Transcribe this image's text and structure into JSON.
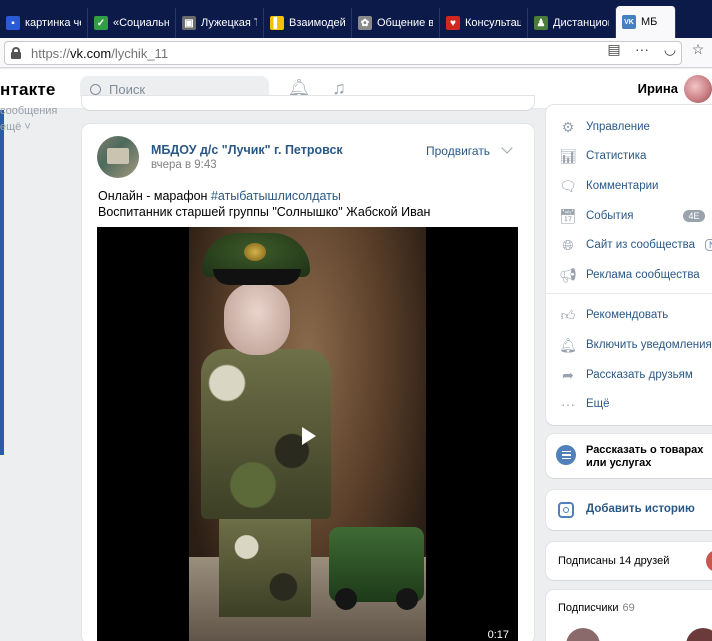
{
  "browser": {
    "tabs": [
      {
        "label": "картинка четв",
        "icon": "search-favicon",
        "color": "#2a5bd7"
      },
      {
        "label": "«Социальные",
        "icon": "check-favicon",
        "color": "#2f9e44"
      },
      {
        "label": "Лужецкая Т.А",
        "icon": "image-favicon",
        "color": "#6b6b6b"
      },
      {
        "label": "Взаимодейств",
        "icon": "yellow-bar-favicon",
        "color": "#f2c200"
      },
      {
        "label": "Общение в со",
        "icon": "leaf-favicon",
        "color": "#8a8a8a"
      },
      {
        "label": "Консультация",
        "icon": "heart-favicon",
        "color": "#d0281e"
      },
      {
        "label": "Дистанционн",
        "icon": "person-favicon",
        "color": "#4a7c3a"
      },
      {
        "label": "МБ",
        "icon": "vk-favicon",
        "color": "#4680c2"
      }
    ],
    "url_prefix": "https://",
    "url_host": "vk.com",
    "url_path": "/lychik_11"
  },
  "header": {
    "logo": "нтакте",
    "search_placeholder": "Поиск",
    "user_name": "Ирина"
  },
  "left": {
    "line1": "сообщения",
    "line2": "ещё ˅"
  },
  "post": {
    "author": "МБДОУ д/с \"Лучик\" г. Петровск",
    "time": "вчера в 9:43",
    "promote": "Продвигать",
    "text_prefix": "Онлайн - марафон ",
    "hashtag": "#атыбатышлисолдаты",
    "text_line2": "Воспитанник старшей группы \"Солнышко\" Жабской Иван",
    "video_duration": "0:17"
  },
  "menu": {
    "items": [
      {
        "label": "Управление",
        "icon": "gear-icon"
      },
      {
        "label": "Статистика",
        "icon": "bar-chart-icon"
      },
      {
        "label": "Комментарии",
        "icon": "comment-icon"
      },
      {
        "label": "События",
        "icon": "calendar-icon",
        "badge": "4E"
      },
      {
        "label": "Сайт из сообщества",
        "icon": "globe-icon",
        "badge": "New"
      },
      {
        "label": "Реклама сообщества",
        "icon": "megaphone-icon"
      },
      {
        "label": "Рекомендовать",
        "icon": "thumbs-up-icon"
      },
      {
        "label": "Включить уведомления",
        "icon": "bell-icon"
      },
      {
        "label": "Рассказать друзьям",
        "icon": "share-icon"
      },
      {
        "label": "Ещё",
        "icon": "more-icon"
      }
    ]
  },
  "shop": {
    "text": "Рассказать о товарах или услугах"
  },
  "story": {
    "label": "Добавить историю"
  },
  "friends": {
    "label": "Подписаны 14 друзей"
  },
  "subscribers": {
    "label": "Подписчики",
    "count": "69"
  }
}
